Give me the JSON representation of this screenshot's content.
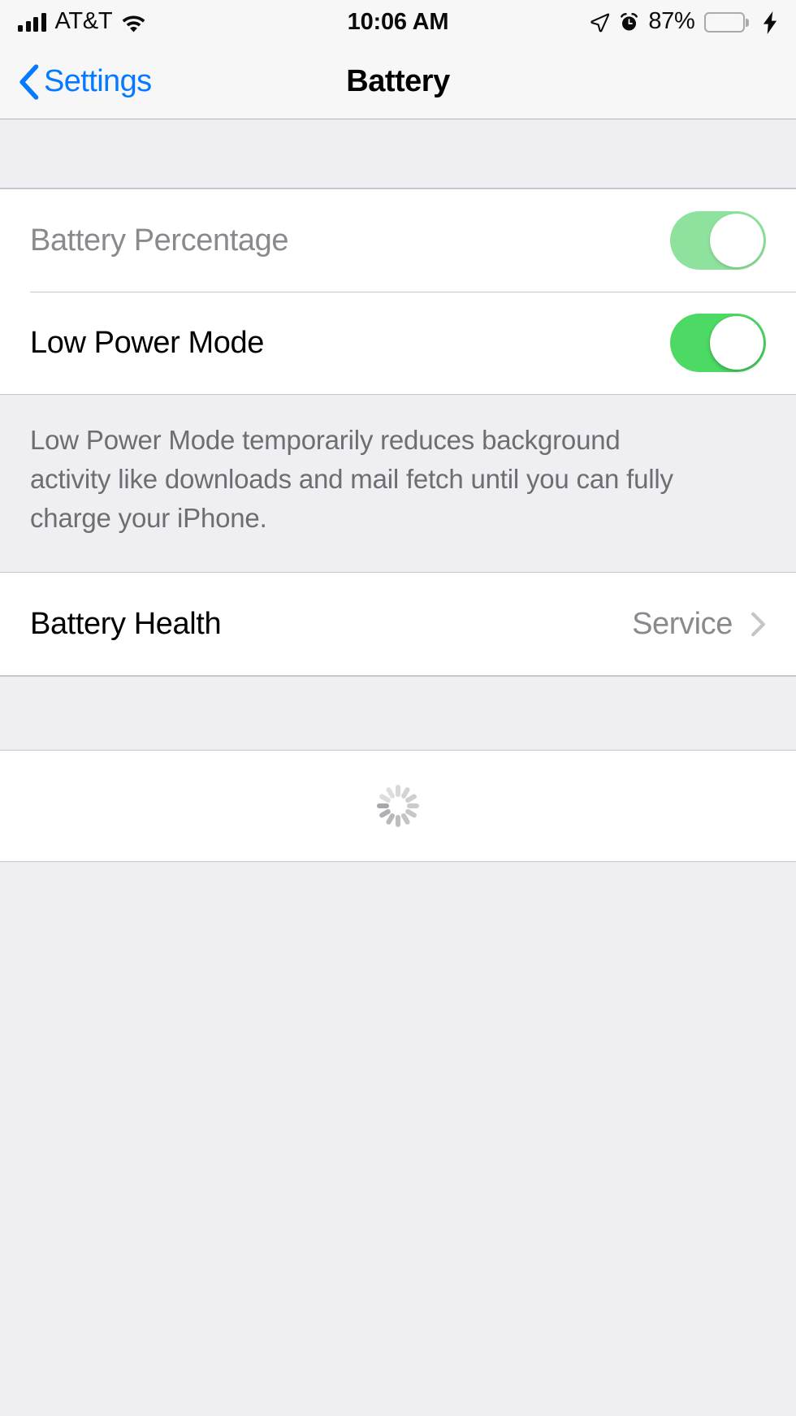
{
  "status_bar": {
    "carrier": "AT&T",
    "signal_bars_filled": 4,
    "signal_bars_total": 4,
    "wifi_icon": "wifi-icon",
    "time": "10:06 AM",
    "location_icon": "location-arrow-icon",
    "alarm_icon": "alarm-clock-icon",
    "battery_percent": "87%",
    "battery_level": 87,
    "battery_color": "#FFCC00",
    "charging_icon": "lightning-bolt-icon"
  },
  "nav_bar": {
    "back_icon": "chevron-left-icon",
    "back_label": "Settings",
    "title": "Battery"
  },
  "settings": {
    "rows": [
      {
        "label": "Battery Percentage",
        "control": "toggle",
        "value": "on",
        "disabled": true
      },
      {
        "label": "Low Power Mode",
        "control": "toggle",
        "value": "on",
        "disabled": false
      }
    ],
    "footer_text": "Low Power Mode temporarily reduces background activity like downloads and mail fetch until you can fully charge your iPhone.",
    "battery_health": {
      "label": "Battery Health",
      "value": "Service",
      "chevron_icon": "chevron-right-icon"
    },
    "loading_indicator": "activity-spinner-icon"
  },
  "colors": {
    "toggle_on": "#4CD964",
    "toggle_dim": "#8EE29D",
    "tint_blue": "#057AFF",
    "page_background": "#EFEEF3",
    "row_background": "#FFFFFF",
    "secondary_text": "#8A8A8E",
    "footer_text": "#6D6D72"
  }
}
